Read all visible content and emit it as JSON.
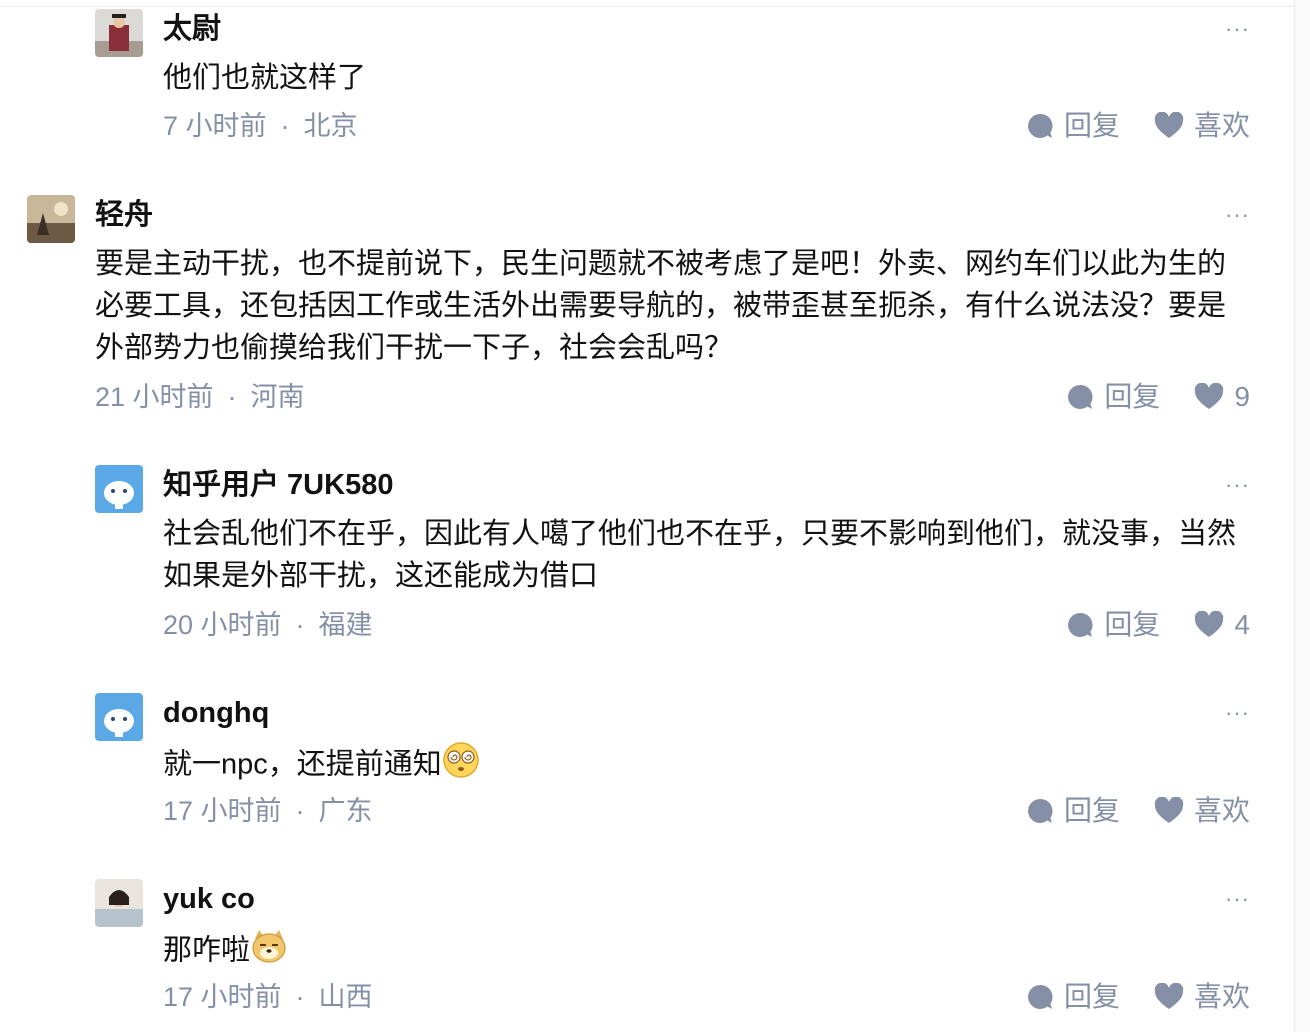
{
  "actions": {
    "reply_label": "回复",
    "like_label": "喜欢"
  },
  "more_glyph": "···",
  "comments": [
    {
      "author": "太尉",
      "text": "他们也就这样了",
      "time": "7 小时前",
      "location": "北京",
      "like_text": "喜欢"
    },
    {
      "author": "轻舟",
      "text": "要是主动干扰，也不提前说下，民生问题就不被考虑了是吧！外卖、网约车们以此为生的必要工具，还包括因工作或生活外出需要导航的，被带歪甚至扼杀，有什么说法没？要是外部势力也偷摸给我们干扰一下子，社会会乱吗？",
      "time": "21 小时前",
      "location": "河南",
      "like_text": "9"
    },
    {
      "author": "知乎用户 7UK580",
      "text": "社会乱他们不在乎，因此有人噶了他们也不在乎，只要不影响到他们，就没事，当然如果是外部干扰，这还能成为借口",
      "time": "20 小时前",
      "location": "福建",
      "like_text": "4"
    },
    {
      "author": "donghq",
      "text": "就一npc，还提前通知",
      "emoji": "dizzy-eyes-emoji",
      "time": "17 小时前",
      "location": "广东",
      "like_text": "喜欢"
    },
    {
      "author": "yuk co",
      "text": "那咋啦",
      "emoji": "doge-emoji",
      "time": "17 小时前",
      "location": "山西",
      "like_text": "喜欢"
    }
  ],
  "colors": {
    "meta": "#8590a6",
    "text": "#121212",
    "avatar_default": "#5aa9e6"
  }
}
